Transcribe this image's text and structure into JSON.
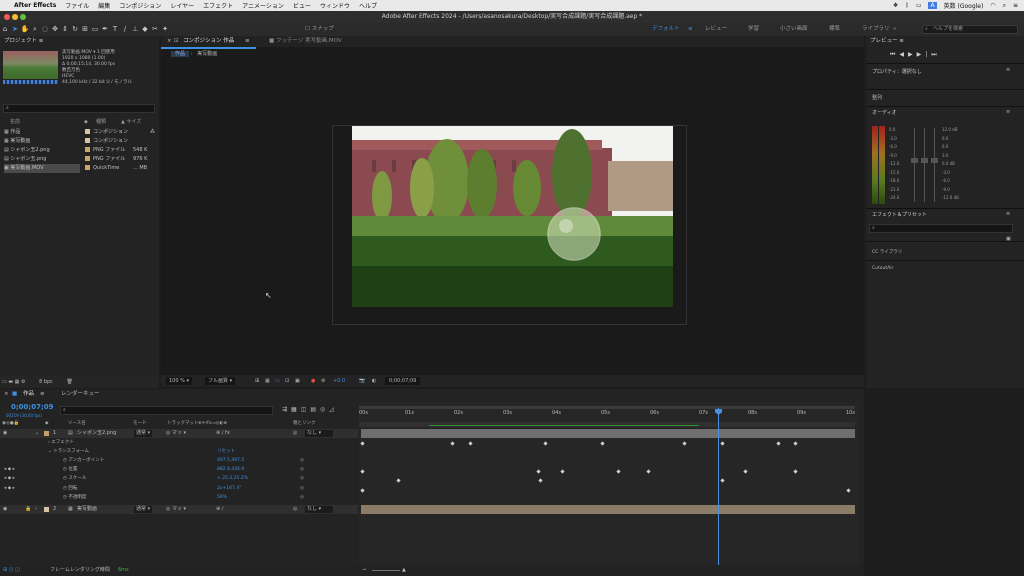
{
  "menubar": {
    "app": "After Effects",
    "items": [
      "ファイル",
      "編集",
      "コンポジション",
      "レイヤー",
      "エフェクト",
      "アニメーション",
      "ビュー",
      "ウィンドウ",
      "ヘルプ"
    ],
    "right_text": "英数 (Google)"
  },
  "window": {
    "title": "Adobe After Effects 2024 - /Users/asanosakura/Desktop/実写合成課題/実写合成課題.aep *"
  },
  "toolbar": {
    "snap_label": "スナップ",
    "workspaces": [
      "デフォルト",
      "レビュー",
      "学習",
      "小さい画面",
      "標準",
      "ライブラリ"
    ],
    "search_placeholder": "ヘルプを検索"
  },
  "project": {
    "title": "プロジェクト",
    "info": [
      "実写動画.MOV ▾ 1 回使用",
      "1920 x 1080 (1.00)",
      "Δ 0;00;15;14, 30.00 fps",
      "数百万色",
      "HEVC",
      "44,100 kHz / 32 bit U / モノラル"
    ],
    "search_placeholder": "",
    "headers": [
      "名前",
      "種類",
      "サイズ"
    ],
    "items": [
      {
        "name": "作品",
        "type": "コンポジション",
        "size": "",
        "color": "#d7c4a0"
      },
      {
        "name": "実写動画",
        "type": "コンポジション",
        "size": "",
        "color": "#d7c4a0"
      },
      {
        "name": "シャボン玉2.png",
        "type": "PNG ファイル",
        "size": "548 K",
        "color": "#c9a86a"
      },
      {
        "name": "シャボン玉.png",
        "type": "PNG ファイル",
        "size": "976 K",
        "color": "#c9a86a"
      },
      {
        "name": "実写動画.MOV",
        "type": "QuickTime",
        "size": "... MB",
        "color": "#c9a86a",
        "selected": true
      }
    ],
    "bpc": "8 bpc"
  },
  "comp": {
    "tab": "コンポジション 作品",
    "footage_tab": "フッテージ 実写動画.MOV",
    "breadcrumbs": [
      "作品",
      "実写動画"
    ],
    "zoom": "100 %",
    "quality": "フル画質",
    "exposure": "+0.0",
    "timecode": "0;00;07;09"
  },
  "right": {
    "preview": "プレビュー",
    "properties": "プロパティ：選択なし",
    "alignment": "整列",
    "audio": "オーディオ",
    "audio_left": [
      "0.0",
      "-3.0",
      "-6.0",
      "-9.0",
      "-12.0",
      "-15.0",
      "-18.0",
      "-21.0",
      "-24.0"
    ],
    "audio_right": [
      "12.0 dB",
      "9.0",
      "6.0",
      "3.0",
      "0.0 dB",
      "-3.0",
      "-6.0",
      "-9.0",
      "-12.0 dB"
    ],
    "effects": "エフェクト＆プリセット",
    "cc_library": "CC ライブラリ",
    "cutout": "CutoutAir"
  },
  "timeline": {
    "tabs": [
      "作品",
      "レンダーキュー"
    ],
    "timecode": "0;00;07;09",
    "fps": "00219 (30.00 fps)",
    "headers": {
      "source": "ソース名",
      "mode": "モード",
      "track": "トラックマット",
      "parent": "親とリンク"
    },
    "layers": [
      {
        "num": "1",
        "name": "シャボン玉2.png",
        "mode": "通常",
        "parent": "なし",
        "color": "#c2a06a"
      },
      {
        "num": "2",
        "name": "実写動画",
        "mode": "通常",
        "parent": "なし",
        "color": "#d7c4a0"
      }
    ],
    "effects": "エフェクト",
    "transform": "トランスフォーム",
    "reset": "リセット",
    "props": [
      {
        "name": "アンカーポイント",
        "value": "497.5,497.5"
      },
      {
        "name": "位置",
        "value": "882.8,434.9"
      },
      {
        "name": "スケール",
        "value": "25.2,25.2%"
      },
      {
        "name": "回転",
        "value": "2x+167.4°"
      },
      {
        "name": "不透明度",
        "value": "56%"
      }
    ],
    "ruler": [
      "00s",
      "01s",
      "02s",
      "03s",
      "04s",
      "05s",
      "06s",
      "07s",
      "08s",
      "09s",
      "10s"
    ],
    "footer": "フレームレンダリング時間",
    "render_time": "6ms"
  },
  "colors": {
    "accent": "#3f8fe0",
    "playhead": "#4a8fe0",
    "bar_layer1": "#6f6f6f",
    "bar_layer2": "#8a7c66"
  }
}
